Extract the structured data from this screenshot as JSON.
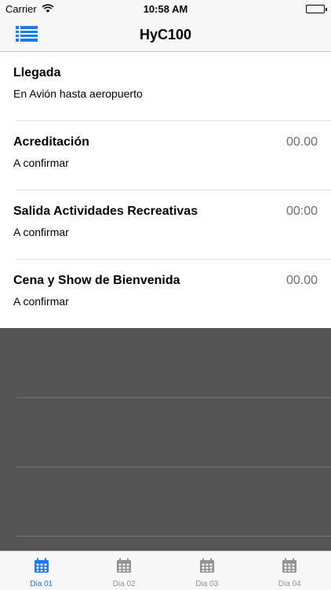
{
  "status_bar": {
    "carrier": "Carrier",
    "time": "10:58 AM"
  },
  "nav": {
    "title": "HyC100"
  },
  "events": [
    {
      "title": "Llegada",
      "subtitle": "En Avión hasta aeropuerto",
      "time": ""
    },
    {
      "title": "Acreditación",
      "subtitle": "A confirmar",
      "time": "00.00"
    },
    {
      "title": "Salida Actividades Recreativas",
      "subtitle": "A confirmar",
      "time": "00:00"
    },
    {
      "title": "Cena y Show de Bienvenida",
      "subtitle": "A confirmar",
      "time": "00.00"
    }
  ],
  "tabs": [
    {
      "label": "Dia 01",
      "icon": "calendar-icon",
      "active": true
    },
    {
      "label": "Dia 02",
      "icon": "calendar-icon",
      "active": false
    },
    {
      "label": "Dia 03",
      "icon": "calendar-icon",
      "active": false
    },
    {
      "label": "Dia 04",
      "icon": "calendar-icon",
      "active": false
    }
  ],
  "colors": {
    "accent": "#1a7ae8",
    "inactive": "#929292",
    "empty_bg": "#555555"
  }
}
